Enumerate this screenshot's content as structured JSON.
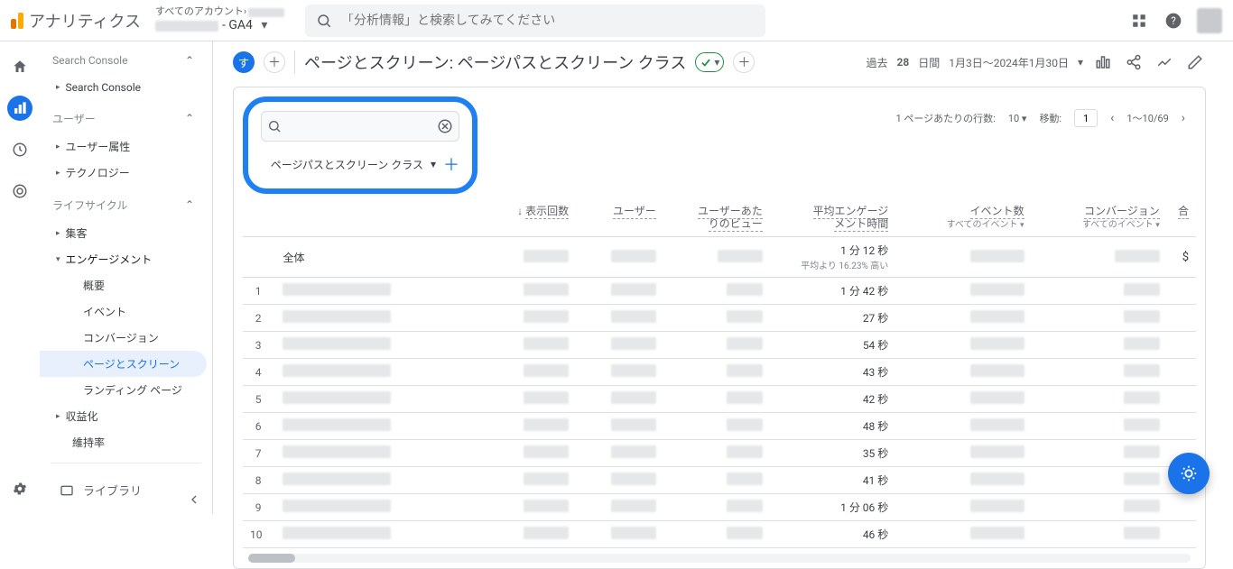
{
  "header": {
    "product": "アナリティクス",
    "account_top_prefix": "すべてのアカウント",
    "account_top_chevron": "›",
    "property_suffix": "- GA4",
    "search_placeholder": "「分析情報」と検索してみてください"
  },
  "sidebar": {
    "sections": {
      "sc": {
        "label": "Search Console",
        "item": "Search Console"
      },
      "user": {
        "label": "ユーザー",
        "attr": "ユーザー属性",
        "tech": "テクノロジー"
      },
      "life": {
        "label": "ライフサイクル",
        "acq": "集客",
        "eng": "エンゲージメント",
        "eng_children": {
          "overview": "概要",
          "events": "イベント",
          "conv": "コンバージョン",
          "pages": "ページとスクリーン",
          "landing": "ランディング ページ"
        },
        "mon": "収益化",
        "ret": "維持率"
      }
    },
    "library": "ライブラリ"
  },
  "title": {
    "tab_badge": "す",
    "text": "ページとスクリーン: ページパスとスクリーン クラス"
  },
  "right": {
    "range_prefix": "過去",
    "range_days": "28",
    "range_suffix": "日間",
    "date_text": "1月3日～2024年1月30日"
  },
  "filter": {
    "placeholder": "",
    "dimension": "ページパスとスクリーン クラス"
  },
  "pager": {
    "rows_label": "1 ページあたりの行数:",
    "rows_value": "10",
    "goto_label": "移動:",
    "goto_value": "1",
    "range": "1～10/69"
  },
  "columns": {
    "views_arrow": "↓",
    "views": "表示回数",
    "users": "ユーザー",
    "views_per_user_1": "ユーザーあた",
    "views_per_user_2": "りのビュー",
    "avg_eng_1": "平均エンゲージ",
    "avg_eng_2": "メント時間",
    "events": "イベント数",
    "events_sub": "すべてのイベント",
    "conv": "コンバージョン",
    "conv_sub": "すべてのイベント",
    "rev": "合"
  },
  "summary": {
    "label": "全体",
    "eng": "1 分 12 秒",
    "eng_note": "平均より 16.23% 高い",
    "rev": "$"
  },
  "rows": [
    {
      "n": 1,
      "eng": "1 分 42 秒"
    },
    {
      "n": 2,
      "eng": "27 秒"
    },
    {
      "n": 3,
      "eng": "54 秒"
    },
    {
      "n": 4,
      "eng": "43 秒"
    },
    {
      "n": 5,
      "eng": "42 秒"
    },
    {
      "n": 6,
      "eng": "48 秒"
    },
    {
      "n": 7,
      "eng": "35 秒"
    },
    {
      "n": 8,
      "eng": "41 秒"
    },
    {
      "n": 9,
      "eng": "1 分 06 秒"
    },
    {
      "n": 10,
      "eng": "46 秒"
    }
  ]
}
